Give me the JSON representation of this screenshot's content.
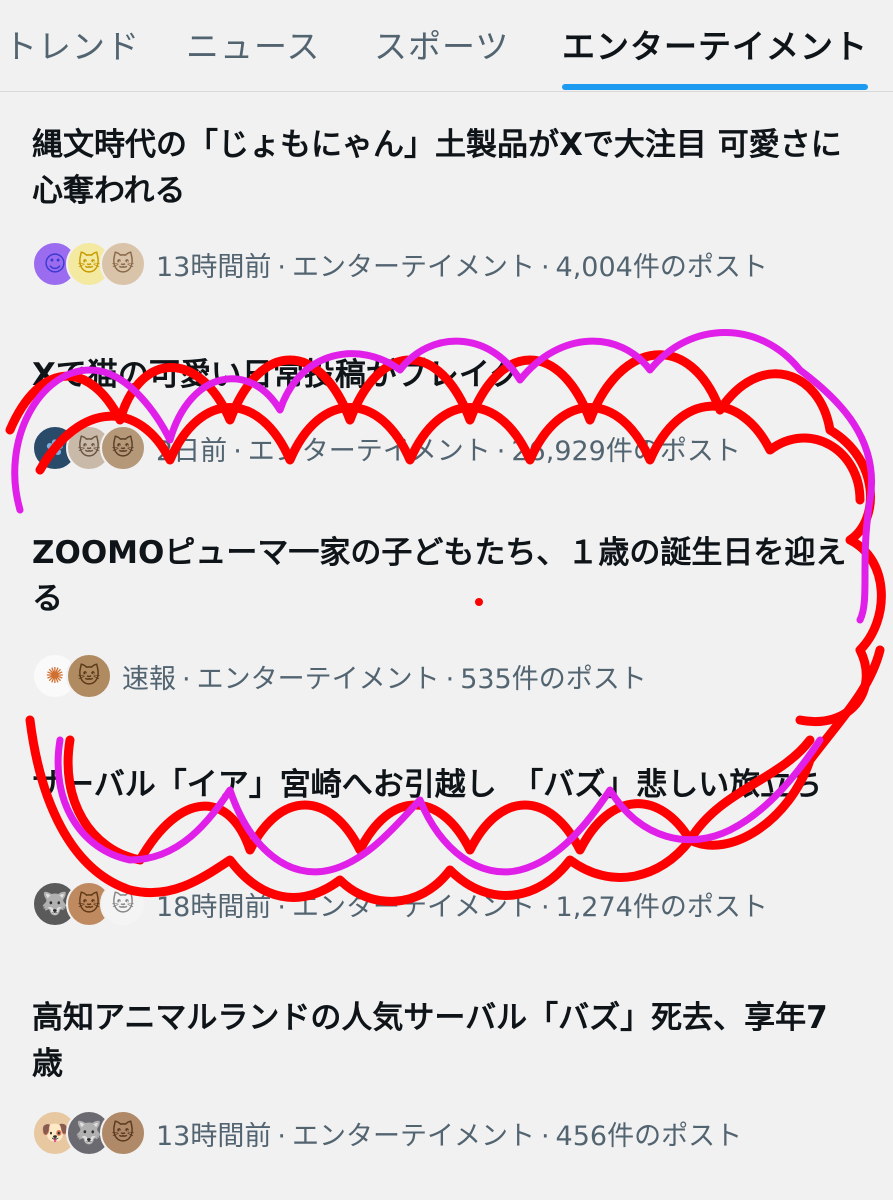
{
  "tabs": [
    {
      "label": "トレンド",
      "active": false
    },
    {
      "label": "ニュース",
      "active": false
    },
    {
      "label": "スポーツ",
      "active": false
    },
    {
      "label": "エンターテイメント",
      "active": true
    }
  ],
  "separator": "·",
  "items": [
    {
      "title": "縄文時代の「じょもにゃん」土製品がXで大注目 可愛さに心奪われる",
      "time": "13時間前",
      "category": "エンターテイメント",
      "posts": "4,004件のポスト",
      "avatars": [
        "cartoon-avatar",
        "cat-avatar",
        "cat-avatar"
      ]
    },
    {
      "title": "Xで猫の可愛い日常投稿がブレイク",
      "time": "2日前",
      "category": "エンターテイメント",
      "posts": "26,929件のポスト",
      "avatars": [
        "flower-avatar",
        "cat-avatar",
        "cat-avatar"
      ]
    },
    {
      "title": "ZOOMOピューマ一家の子どもたち、１歳の誕生日を迎える",
      "time": "速報",
      "category": "エンターテイメント",
      "posts": "535件のポスト",
      "avatars": [
        "logo-avatar",
        "cat-avatar"
      ]
    },
    {
      "title": "サーバル「イア」宮崎へお引越し　「バズ」悲しい旅立ち",
      "time": "18時間前",
      "category": "エンターテイメント",
      "posts": "1,274件のポスト",
      "avatars": [
        "wolf-avatar",
        "cat-avatar",
        "cat-avatar"
      ]
    },
    {
      "title": "高知アニマルランドの人気サーバル「バズ」死去、享年7歳",
      "time": "13時間前",
      "category": "エンターテイメント",
      "posts": "456件のポスト",
      "avatars": [
        "dog-avatar",
        "wolf-avatar",
        "cat-avatar"
      ]
    }
  ],
  "colors": {
    "accent": "#1d9bf0",
    "scribble_red": "#ff0000",
    "scribble_magenta": "#e020e8"
  }
}
